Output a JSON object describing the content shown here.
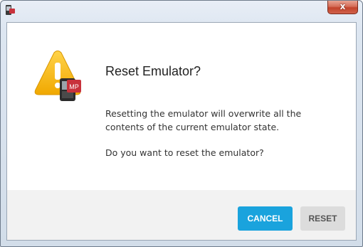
{
  "window": {
    "app_icon": "emulator-app-icon",
    "close_label": "x"
  },
  "dialog": {
    "icon": "warning-emulator-icon",
    "icon_badge": "MP",
    "title": "Reset Emulator?",
    "message": "Resetting the emulator will overwrite all the contents of the current emulator state.",
    "question": "Do you want to reset the emulator?"
  },
  "buttons": {
    "cancel_label": "CANCEL",
    "reset_label": "RESET"
  },
  "colors": {
    "accent": "#1aa3dd",
    "warning": "#f2b705",
    "badge": "#c8323c"
  }
}
